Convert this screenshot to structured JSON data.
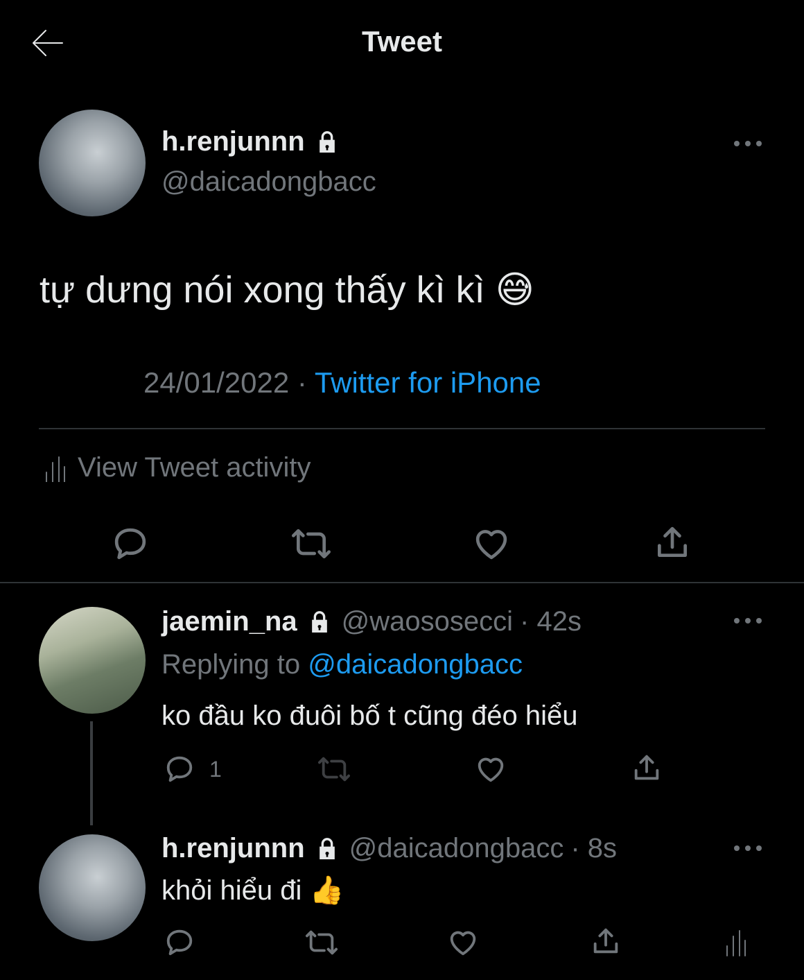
{
  "header": {
    "title": "Tweet"
  },
  "main_tweet": {
    "display_name": "h.renjunnn",
    "handle": "@daicadongbacc",
    "text": "tự dưng nói xong thấy kì kì 😅",
    "date": "24/01/2022",
    "separator": "·",
    "source": "Twitter for iPhone",
    "activity_label": "View Tweet activity"
  },
  "reply1": {
    "display_name": "jaemin_na",
    "handle": "@waososecci",
    "time": "· 42s",
    "replying_prefix": "Replying to",
    "replying_to": "@daicadongbacc",
    "text": "ko đầu ko đuôi bố t cũng đéo hiểu",
    "reply_count": "1"
  },
  "reply2": {
    "display_name": "h.renjunnn",
    "handle": "@daicadongbacc",
    "time": "· 8s",
    "text": "khỏi hiểu đi 👍"
  },
  "colors": {
    "background": "#000000",
    "text_primary": "#e7e9ea",
    "text_secondary": "#71767b",
    "accent": "#1d9bf0",
    "divider": "#2f3336"
  }
}
